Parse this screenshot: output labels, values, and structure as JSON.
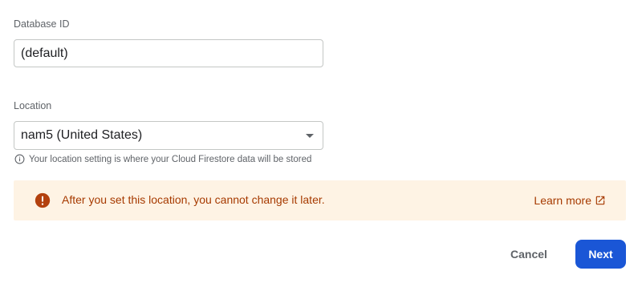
{
  "database": {
    "label": "Database ID",
    "value": "(default)"
  },
  "location": {
    "label": "Location",
    "selected": "nam5 (United States)",
    "hint_icon": "info-icon",
    "hint": "Your location setting is where your Cloud Firestore data will be stored"
  },
  "warning": {
    "icon": "error-icon",
    "message": "After you set this location, you cannot change it later.",
    "link_label": "Learn more",
    "link_icon": "open-in-new-icon",
    "background": "#fef3e4",
    "text_color": "#a63a00"
  },
  "actions": {
    "cancel_label": "Cancel",
    "next_label": "Next",
    "primary_color": "#1a56d6"
  }
}
